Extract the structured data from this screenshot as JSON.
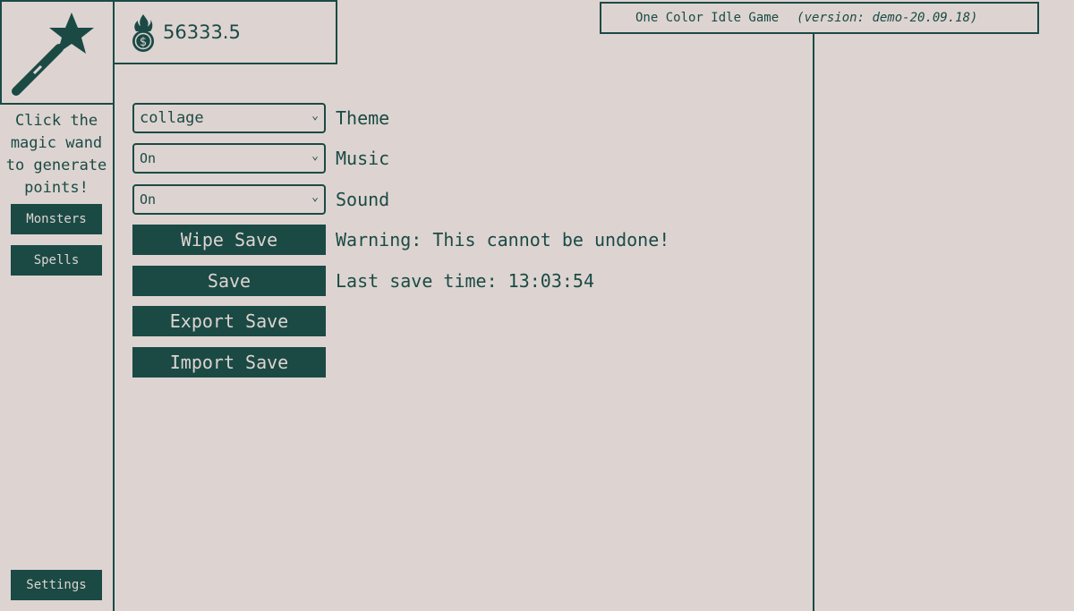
{
  "sidebar": {
    "wand_hint": "Click the magic wand to generate points!",
    "buttons": {
      "monsters": "Monsters",
      "spells": "Spells",
      "settings": "Settings"
    }
  },
  "header": {
    "points": "56333.5",
    "game_title": "One Color Idle Game",
    "version": "(version: demo-20.09.18)"
  },
  "settings": {
    "theme": {
      "value": "collage",
      "label": "Theme"
    },
    "music": {
      "value": "On",
      "label": "Music"
    },
    "sound": {
      "value": "On",
      "label": "Sound"
    },
    "wipe_save": {
      "button": "Wipe Save",
      "note": "Warning: This cannot be undone!"
    },
    "save": {
      "button": "Save",
      "note": "Last save time: 13:03:54"
    },
    "export_save": {
      "button": "Export Save"
    },
    "import_save": {
      "button": "Import Save"
    }
  },
  "colors": {
    "primary": "#1b4a45",
    "background": "#ddd4d1"
  }
}
